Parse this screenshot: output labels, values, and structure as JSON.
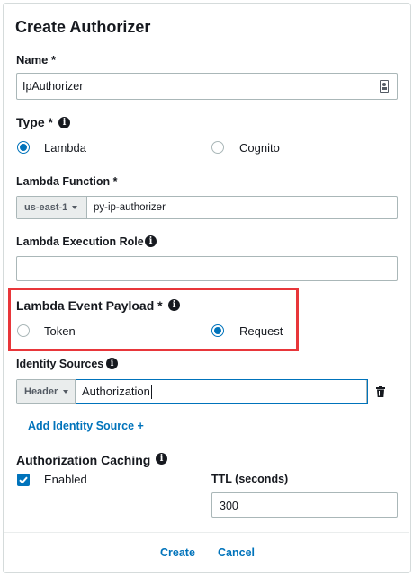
{
  "dialog": {
    "title": "Create Authorizer"
  },
  "name": {
    "label": "Name *",
    "value": "IpAuthorizer"
  },
  "type": {
    "label": "Type *",
    "options": [
      {
        "label": "Lambda",
        "selected": true
      },
      {
        "label": "Cognito",
        "selected": false
      }
    ]
  },
  "lambda_function": {
    "label": "Lambda Function *",
    "region": "us-east-1",
    "value": "py-ip-authorizer"
  },
  "execution_role": {
    "label": "Lambda Execution Role",
    "value": ""
  },
  "event_payload": {
    "label": "Lambda Event Payload *",
    "options": [
      {
        "label": "Token",
        "selected": false
      },
      {
        "label": "Request",
        "selected": true
      }
    ]
  },
  "identity_sources": {
    "label": "Identity Sources",
    "source_type": "Header",
    "value": "Authorization",
    "add_link": "Add Identity Source +"
  },
  "caching": {
    "label": "Authorization Caching",
    "enabled_label": "Enabled",
    "enabled": true,
    "ttl_label": "TTL (seconds)",
    "ttl_value": "300"
  },
  "footer": {
    "create_label": "Create",
    "cancel_label": "Cancel"
  },
  "colors": {
    "accent": "#0073bb",
    "highlight": "#e8363a"
  },
  "icons": [
    "info-icon",
    "contact-card-icon",
    "caret-down-icon",
    "trash-icon",
    "checkmark-icon"
  ]
}
